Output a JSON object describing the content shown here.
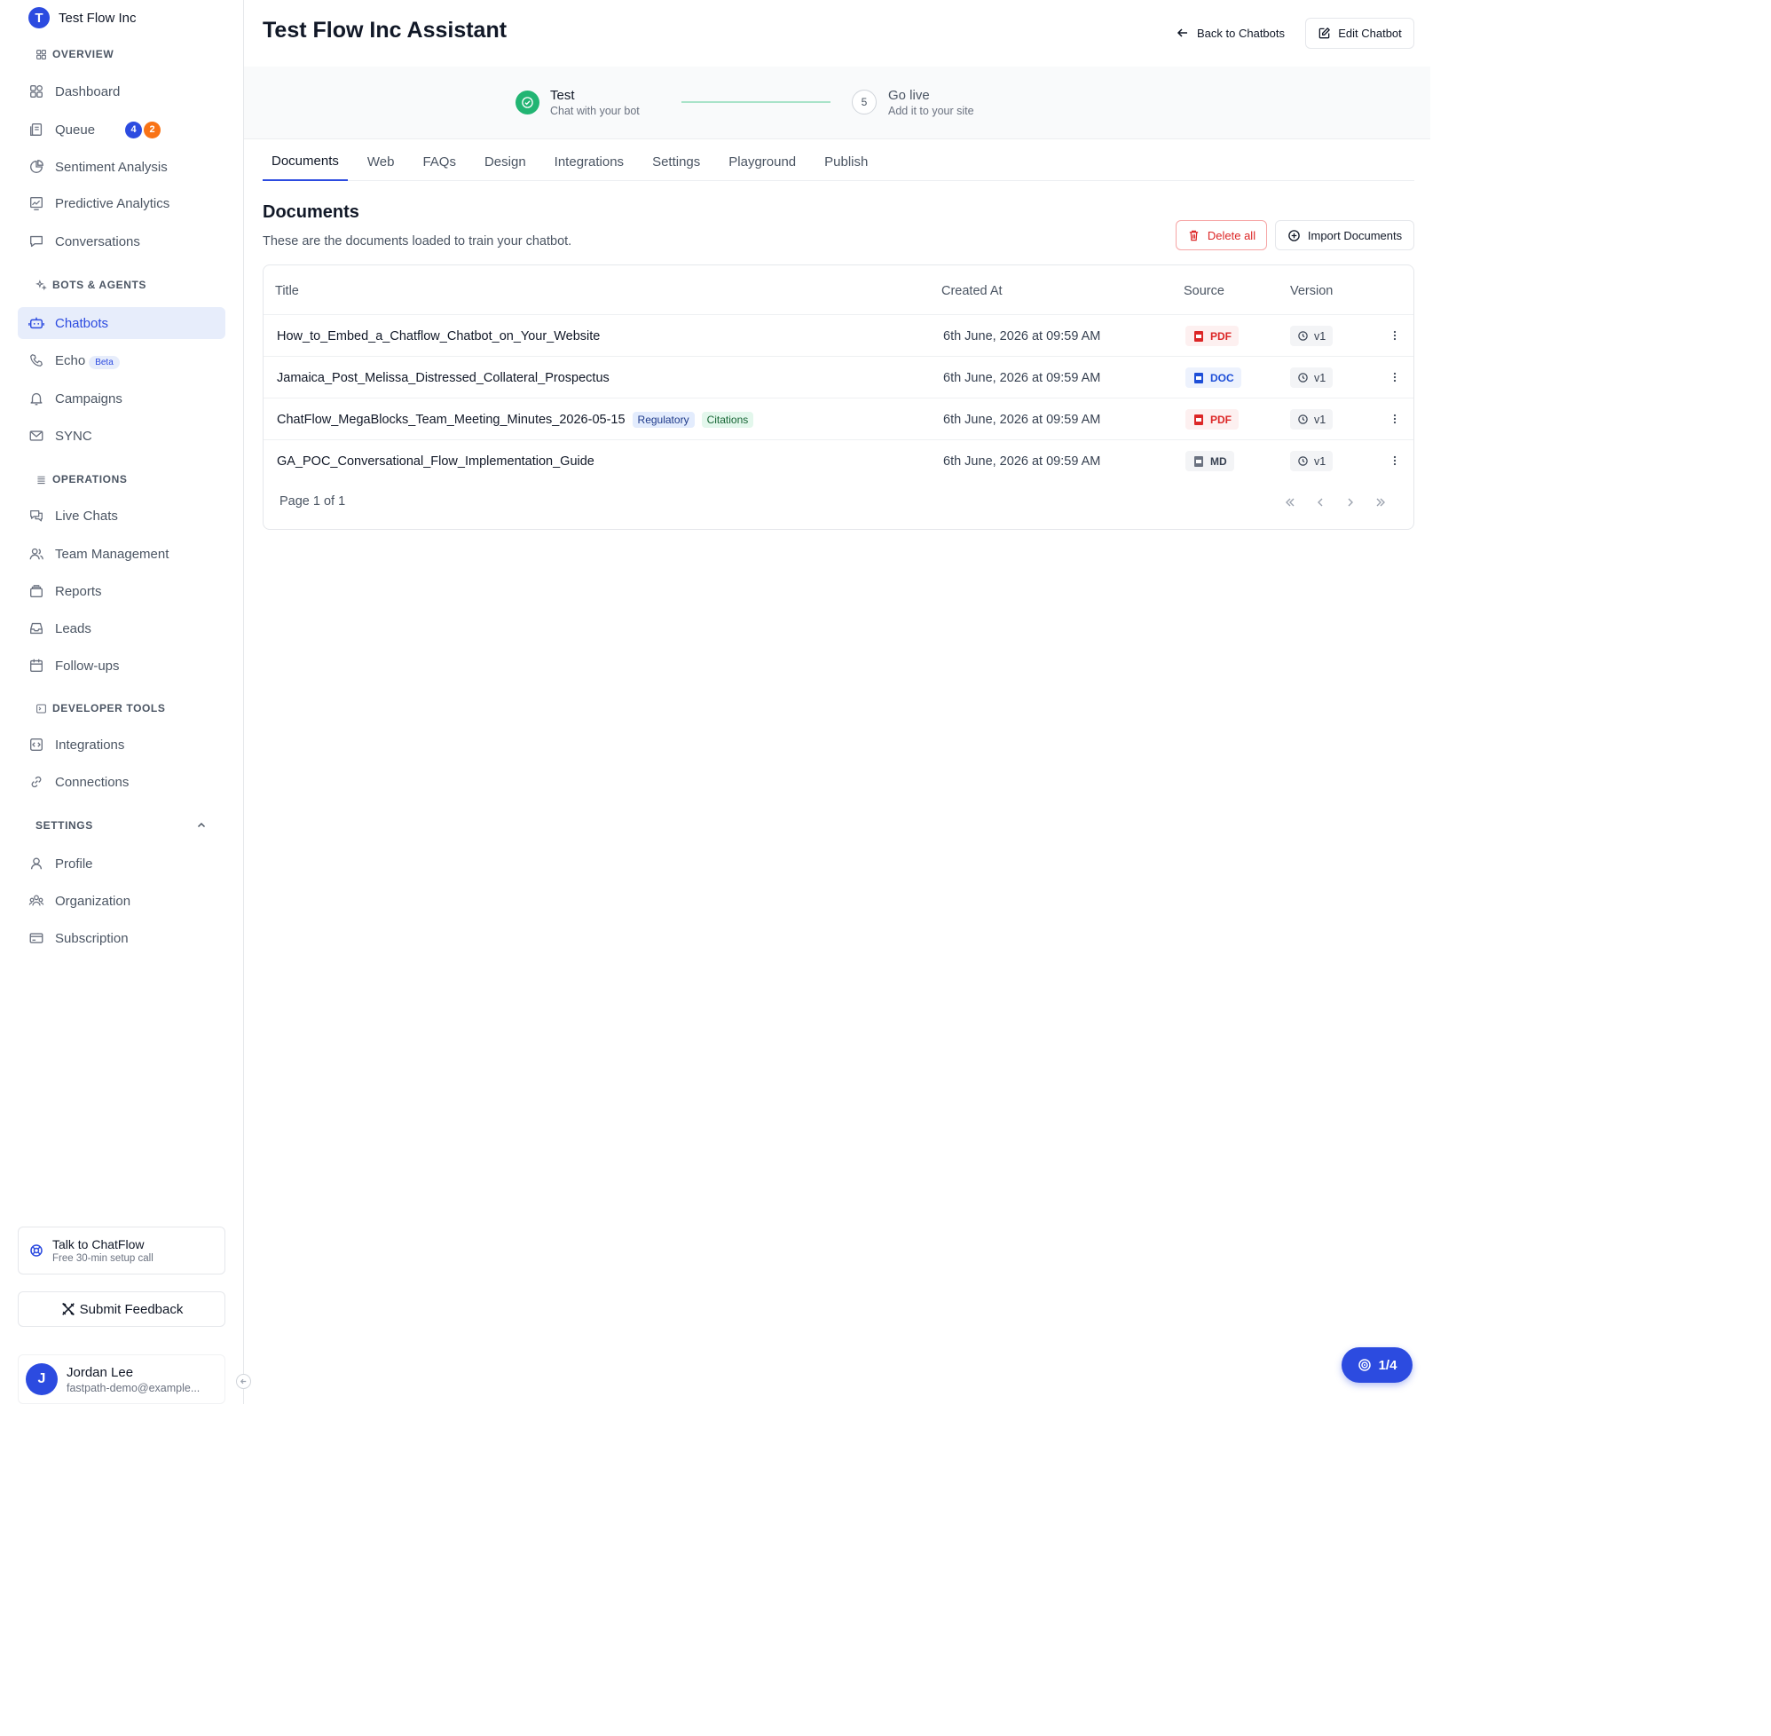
{
  "sidebar": {
    "org": {
      "initial": "T",
      "name": "Test Flow Inc"
    },
    "sections": {
      "overview": "OVERVIEW",
      "bots": "BOTS & AGENTS",
      "operations": "OPERATIONS",
      "developer": "DEVELOPER TOOLS",
      "settings": "SETTINGS"
    },
    "items": {
      "dashboard": "Dashboard",
      "queue": "Queue",
      "queue_badge_blue": "4",
      "queue_badge_orange": "2",
      "sentiment": "Sentiment Analysis",
      "predictive": "Predictive Analytics",
      "conversations": "Conversations",
      "chatbots": "Chatbots",
      "echo": "Echo",
      "echo_badge": "Beta",
      "campaigns": "Campaigns",
      "sync": "SYNC",
      "live_chats": "Live Chats",
      "team": "Team Management",
      "reports": "Reports",
      "leads": "Leads",
      "followups": "Follow-ups",
      "integrations": "Integrations",
      "connections": "Connections",
      "profile": "Profile",
      "organization": "Organization",
      "subscription": "Subscription"
    },
    "cta": {
      "title": "Talk to ChatFlow",
      "subtitle": "Free 30-min setup call"
    },
    "feedback": "Submit Feedback",
    "user": {
      "initial": "J",
      "name": "Jordan Lee",
      "email": "fastpath-demo@example..."
    }
  },
  "header": {
    "title": "Test Flow Inc Assistant",
    "back": "Back to Chatbots",
    "edit": "Edit Chatbot"
  },
  "stepper": {
    "step1": {
      "title": "Test",
      "subtitle": "Chat with your bot"
    },
    "step2": {
      "number": "5",
      "title": "Go live",
      "subtitle": "Add it to your site"
    }
  },
  "tabs": [
    "Documents",
    "Web",
    "FAQs",
    "Design",
    "Integrations",
    "Settings",
    "Playground",
    "Publish"
  ],
  "documents": {
    "title": "Documents",
    "description": "These are the documents loaded to train your chatbot.",
    "delete_all": "Delete all",
    "import": "Import Documents",
    "columns": {
      "title": "Title",
      "created": "Created At",
      "source": "Source",
      "version": "Version"
    },
    "rows": [
      {
        "title": "How_to_Embed_a_Chatflow_Chatbot_on_Your_Website",
        "created": "6th June, 2026 at 09:59 AM",
        "source": "PDF",
        "version": "v1"
      },
      {
        "title": "Jamaica_Post_Melissa_Distressed_Collateral_Prospectus",
        "created": "6th June, 2026 at 09:59 AM",
        "source": "DOC",
        "version": "v1"
      },
      {
        "title": "ChatFlow_MegaBlocks_Team_Meeting_Minutes_2026-05-15",
        "tags": [
          "Regulatory",
          "Citations"
        ],
        "created": "6th June, 2026 at 09:59 AM",
        "source": "PDF",
        "version": "v1"
      },
      {
        "title": "GA_POC_Conversational_Flow_Implementation_Guide",
        "created": "6th June, 2026 at 09:59 AM",
        "source": "MD",
        "version": "v1"
      }
    ],
    "pager": "Page 1 of 1"
  },
  "tour": {
    "label": "1/4"
  },
  "colors": {
    "accent": "#2c4be0",
    "success": "#22b573",
    "danger": "#dc2626",
    "warning": "#f97316"
  }
}
